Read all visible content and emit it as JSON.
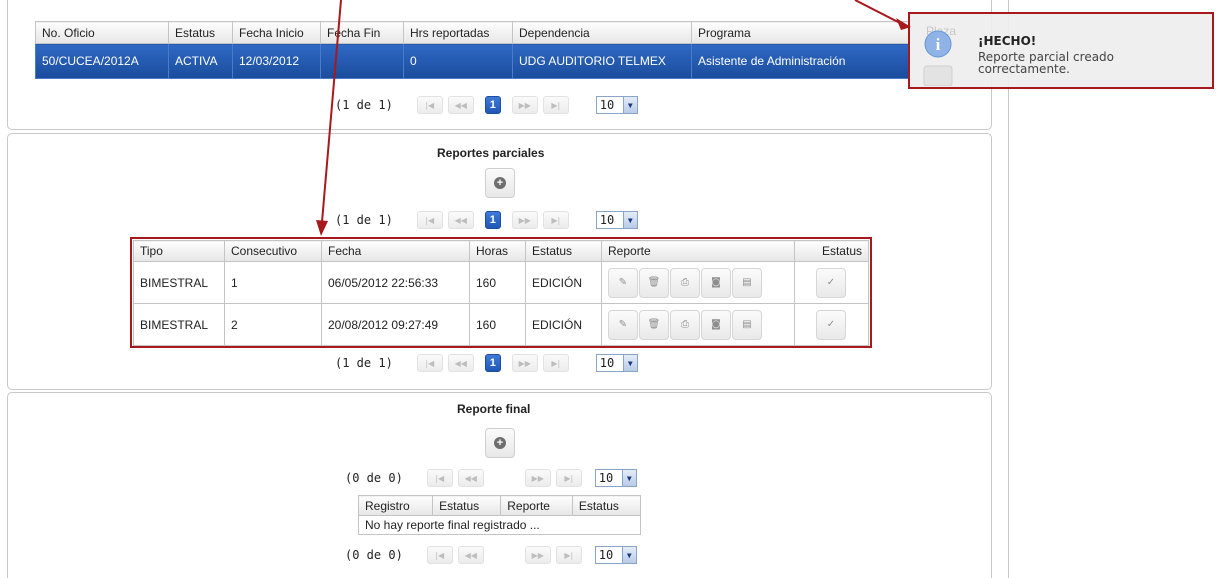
{
  "top_table": {
    "headers": [
      "No. Oficio",
      "Estatus",
      "Fecha Inicio",
      "Fecha Fin",
      "Hrs reportadas",
      "Dependencia",
      "Programa"
    ],
    "row": [
      "50/CUCEA/2012A",
      "ACTIVA",
      "12/03/2012",
      "",
      "0",
      "UDG AUDITORIO TELMEX",
      "Asistente de Administración"
    ],
    "pager": {
      "count": "(1 de 1)",
      "page": "1",
      "rows": "10"
    }
  },
  "reportes_parciales": {
    "title": "Reportes parciales",
    "pager_top": {
      "count": "(1 de 1)",
      "page": "1",
      "rows": "10"
    },
    "headers": [
      "Tipo",
      "Consecutivo",
      "Fecha",
      "Horas",
      "Estatus",
      "Reporte",
      "Estatus"
    ],
    "rows": [
      {
        "tipo": "BIMESTRAL",
        "consecutivo": "1",
        "fecha": "06/05/2012 22:56:33",
        "horas": "160",
        "estatus": "EDICIÓN"
      },
      {
        "tipo": "BIMESTRAL",
        "consecutivo": "2",
        "fecha": "20/08/2012 09:27:49",
        "horas": "160",
        "estatus": "EDICIÓN"
      }
    ],
    "pager_bottom": {
      "count": "(1 de 1)",
      "page": "1",
      "rows": "10"
    }
  },
  "reporte_final": {
    "title": "Reporte final",
    "pager_top": {
      "count": "(0 de 0)",
      "rows": "10"
    },
    "headers": [
      "Registro",
      "Estatus",
      "Reporte",
      "Estatus"
    ],
    "empty_message": "No hay reporte final registrado ...",
    "pager_bottom": {
      "count": "(0 de 0)",
      "rows": "10"
    }
  },
  "notification": {
    "ghost_label": "Plaza",
    "title": "¡HECHO!",
    "message": "Reporte parcial creado correctamente."
  },
  "icons": {
    "pager_first": "first-page-icon",
    "pager_prev": "prev-page-icon",
    "pager_next": "next-page-icon",
    "pager_last": "last-page-icon",
    "add": "plus-circle-icon",
    "edit": "pencil-icon",
    "delete": "trash-icon",
    "print": "print-icon",
    "comment": "comment-icon",
    "save": "save-icon",
    "approve": "check-icon",
    "notification": "info-icon"
  },
  "colors": {
    "selected_row": "#2457ad",
    "annotation_red": "#a8191e",
    "page_active": "#2a63c2"
  }
}
